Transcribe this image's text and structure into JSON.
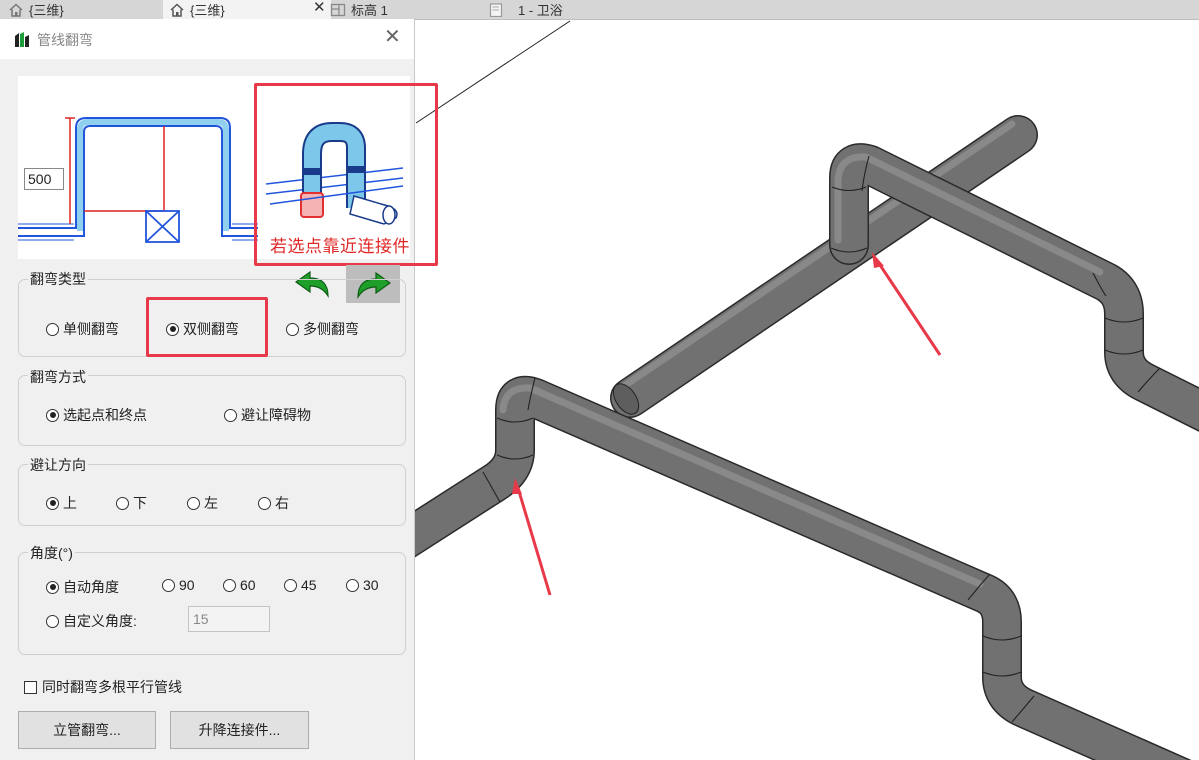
{
  "tabs": [
    {
      "label": "{三维}",
      "icon": "home-icon"
    },
    {
      "label": "{三维}",
      "icon": "home-icon",
      "active": true
    },
    {
      "label": "标高 1",
      "icon": "floorplan-icon"
    },
    {
      "label": "1 - 卫浴",
      "icon": "sheet-icon"
    }
  ],
  "dialog": {
    "title": "管线翻弯",
    "preview": {
      "dimension_value": "500",
      "caption": "若选点靠近连接件"
    },
    "groups": {
      "bend_type": {
        "label": "翻弯类型",
        "options": [
          "单侧翻弯",
          "双侧翻弯",
          "多侧翻弯"
        ],
        "selected": "双侧翻弯"
      },
      "bend_method": {
        "label": "翻弯方式",
        "options": [
          "选起点和终点",
          "避让障碍物"
        ],
        "selected": "选起点和终点"
      },
      "avoid_direction": {
        "label": "避让方向",
        "options": [
          "上",
          "下",
          "左",
          "右"
        ],
        "selected": "上"
      },
      "angle": {
        "label": "角度(°)",
        "options": [
          "自动角度",
          "90",
          "60",
          "45",
          "30"
        ],
        "custom_label": "自定义角度:",
        "custom_value": "15",
        "selected": "自动角度"
      }
    },
    "multi_parallel_label": "同时翻弯多根平行管线",
    "buttons": {
      "riser_bend": "立管翻弯...",
      "lift_connector": "升降连接件..."
    }
  },
  "colors": {
    "highlight_red": "#e8394a",
    "pipe_gray": "#6e6e6e",
    "arrow_green": "#1f9e2a",
    "pipe_blue": "#7cc7ea"
  }
}
